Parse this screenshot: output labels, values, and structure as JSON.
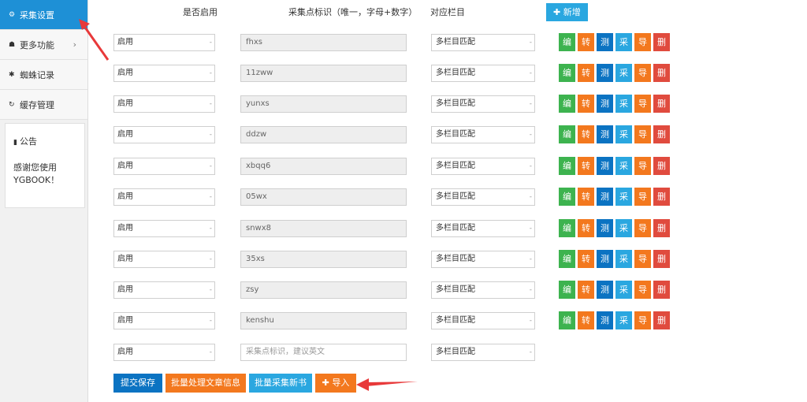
{
  "sidebar": {
    "items": [
      {
        "icon": "gears-icon",
        "glyph": "⚙",
        "label": "采集设置"
      },
      {
        "icon": "sitemap-icon",
        "glyph": "☗",
        "label": "更多功能",
        "chevron": "›"
      },
      {
        "icon": "spider-icon",
        "glyph": "✱",
        "label": "蜘蛛记录"
      },
      {
        "icon": "refresh-icon",
        "glyph": "↻",
        "label": "缓存管理"
      }
    ],
    "notice": {
      "icon": "bookmark-icon",
      "glyph": "▮",
      "title": "公告",
      "line1": "感谢您使用",
      "line2": "YGBOOK！"
    }
  },
  "headers": {
    "enabled": "是否启用",
    "identifier": "采集点标识（唯一，字母+数字）",
    "column": "对应栏目"
  },
  "add_button": "✚ 新增",
  "action_labels": {
    "edit": "编辑",
    "transfer": "转移",
    "test": "测试",
    "collect": "采集",
    "export": "导出",
    "delete": "删除"
  },
  "rows": [
    {
      "enabled": "启用",
      "identifier": "fhxs",
      "column": "多栏目匹配"
    },
    {
      "enabled": "启用",
      "identifier": "11zww",
      "column": "多栏目匹配"
    },
    {
      "enabled": "启用",
      "identifier": "yunxs",
      "column": "多栏目匹配"
    },
    {
      "enabled": "启用",
      "identifier": "ddzw",
      "column": "多栏目匹配"
    },
    {
      "enabled": "启用",
      "identifier": "xbqq6",
      "column": "多栏目匹配"
    },
    {
      "enabled": "启用",
      "identifier": "05wx",
      "column": "多栏目匹配"
    },
    {
      "enabled": "启用",
      "identifier": "snwx8",
      "column": "多栏目匹配"
    },
    {
      "enabled": "启用",
      "identifier": "35xs",
      "column": "多栏目匹配"
    },
    {
      "enabled": "启用",
      "identifier": "zsy",
      "column": "多栏目匹配"
    },
    {
      "enabled": "启用",
      "identifier": "kenshu",
      "column": "多栏目匹配"
    }
  ],
  "new_row": {
    "enabled": "启用",
    "placeholder": "采集点标识，建议英文",
    "column": "多栏目匹配"
  },
  "select_arrow": "-",
  "bottom": {
    "save": "提交保存",
    "batch_process": "批量处理文章信息",
    "batch_collect": "批量采集新书",
    "import": "✚ 导入"
  },
  "colors": {
    "active": "#1e90d6",
    "green": "#3db34f",
    "orange": "#f3781e",
    "blue": "#0b73c2",
    "cyan": "#2aa7e0",
    "red": "#e04b3e",
    "arrow": "#e8393a"
  }
}
